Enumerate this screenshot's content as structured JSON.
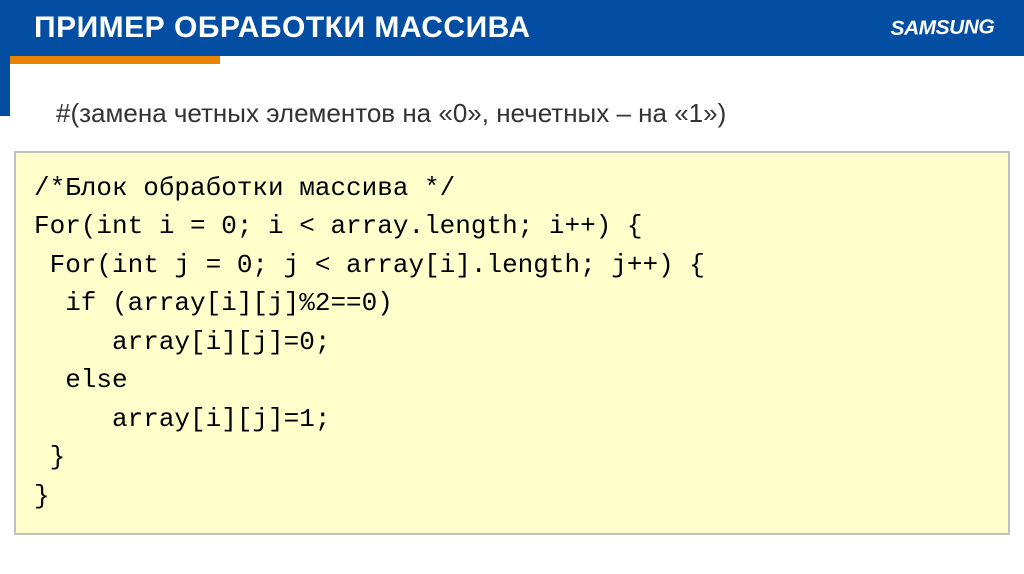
{
  "header": {
    "title": "ПРИМЕР ОБРАБОТКИ МАССИВА",
    "logo": "SAMSUNG"
  },
  "subtitle": "#(замена четных элементов на «0», нечетных – на «1»)",
  "code": "/*Блок обработки массива */\nFor(int i = 0; i < array.length; i++) {\n For(int j = 0; j < array[i].length; j++) {\n  if (array[i][j]%2==0)\n     array[i][j]=0;\n  else\n     array[i][j]=1;\n }\n}"
}
